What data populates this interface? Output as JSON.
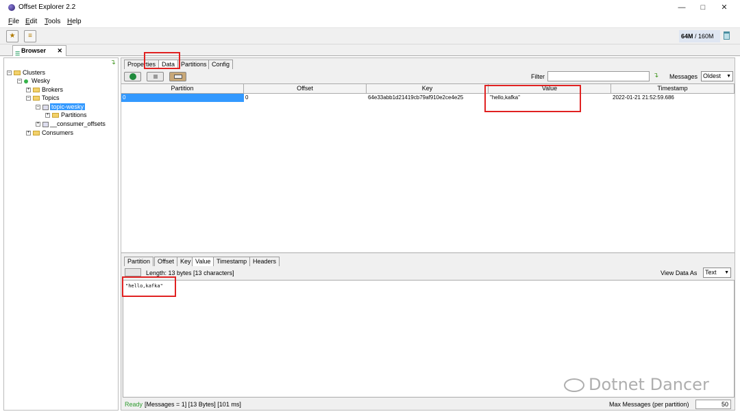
{
  "window": {
    "title": "Offset Explorer  2.2",
    "minimize": "—",
    "maximize": "□",
    "close": "✕"
  },
  "menu": {
    "file": {
      "mnemonic": "F",
      "rest": "ile"
    },
    "edit": {
      "mnemonic": "E",
      "rest": "dit"
    },
    "tools": {
      "mnemonic": "T",
      "rest": "ools"
    },
    "help": {
      "mnemonic": "H",
      "rest": "elp"
    }
  },
  "toolbar": {
    "memory_used": "64M",
    "memory_total": " / 160M"
  },
  "browser_tab": {
    "label": "Browser",
    "close": "✕"
  },
  "tree": {
    "clusters": "Clusters",
    "cluster": "Wesky",
    "brokers": "Brokers",
    "topics": "Topics",
    "topic_selected": "topic-wesky",
    "partitions": "Partitions",
    "consumer_offsets": "__consumer_offsets",
    "consumers": "Consumers"
  },
  "tabs": [
    "Properties",
    "Data",
    "Partitions",
    "Config"
  ],
  "filter": {
    "label": "Filter",
    "value": ""
  },
  "messages": {
    "label": "Messages",
    "selected": "Oldest"
  },
  "grid": {
    "columns": [
      "Partition",
      "Offset",
      "Key",
      "Value",
      "Timestamp"
    ],
    "rows": [
      {
        "partition": "0",
        "offset": "0",
        "key": "64e33abb1d21419cb79af910e2ce4e25",
        "value": "\"hello,kafka\"",
        "timestamp": "2022-01-21 21:52:59.686"
      }
    ]
  },
  "detail_tabs": [
    "Partition",
    "Offset",
    "Key",
    "Value",
    "Timestamp",
    "Headers"
  ],
  "detail": {
    "length_text": "Length: 13 bytes [13 characters]",
    "view_as_label": "View Data As",
    "view_as_selected": "Text",
    "value": "\"hello,kafka\""
  },
  "status": {
    "ready": "Ready",
    "info": "[Messages = 1]  [13 Bytes]  [101 ms]",
    "max_label": "Max Messages (per partition)",
    "max_value": "50"
  },
  "watermark": "Dotnet Dancer",
  "colors": {
    "highlight": "#e02020",
    "selection": "#3399ff",
    "ready": "#2e9b2e"
  }
}
